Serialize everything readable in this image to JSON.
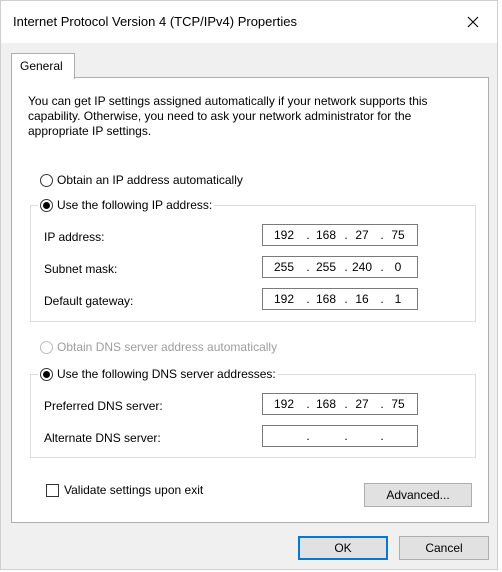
{
  "window": {
    "title": "Internet Protocol Version 4 (TCP/IPv4) Properties"
  },
  "tabs": [
    {
      "label": "General"
    }
  ],
  "description": "You can get IP settings assigned automatically if your network supports this capability. Otherwise, you need to ask your network administrator for the appropriate IP settings.",
  "ip": {
    "auto_label": "Obtain an IP address automatically",
    "manual_label": "Use the following IP address:",
    "fields": [
      {
        "label": "IP address:",
        "octets": [
          "192",
          "168",
          "27",
          "75"
        ]
      },
      {
        "label": "Subnet mask:",
        "octets": [
          "255",
          "255",
          "240",
          "0"
        ]
      },
      {
        "label": "Default gateway:",
        "octets": [
          "192",
          "168",
          "16",
          "1"
        ]
      }
    ]
  },
  "dns": {
    "auto_label": "Obtain DNS server address automatically",
    "manual_label": "Use the following DNS server addresses:",
    "fields": [
      {
        "label": "Preferred DNS server:",
        "octets": [
          "192",
          "168",
          "27",
          "75"
        ]
      },
      {
        "label": "Alternate DNS server:",
        "octets": [
          "",
          "",
          "",
          ""
        ]
      }
    ]
  },
  "validate_label": "Validate settings upon exit",
  "buttons": {
    "advanced": "Advanced...",
    "ok": "OK",
    "cancel": "Cancel"
  },
  "icons": {
    "close": "close-icon"
  }
}
